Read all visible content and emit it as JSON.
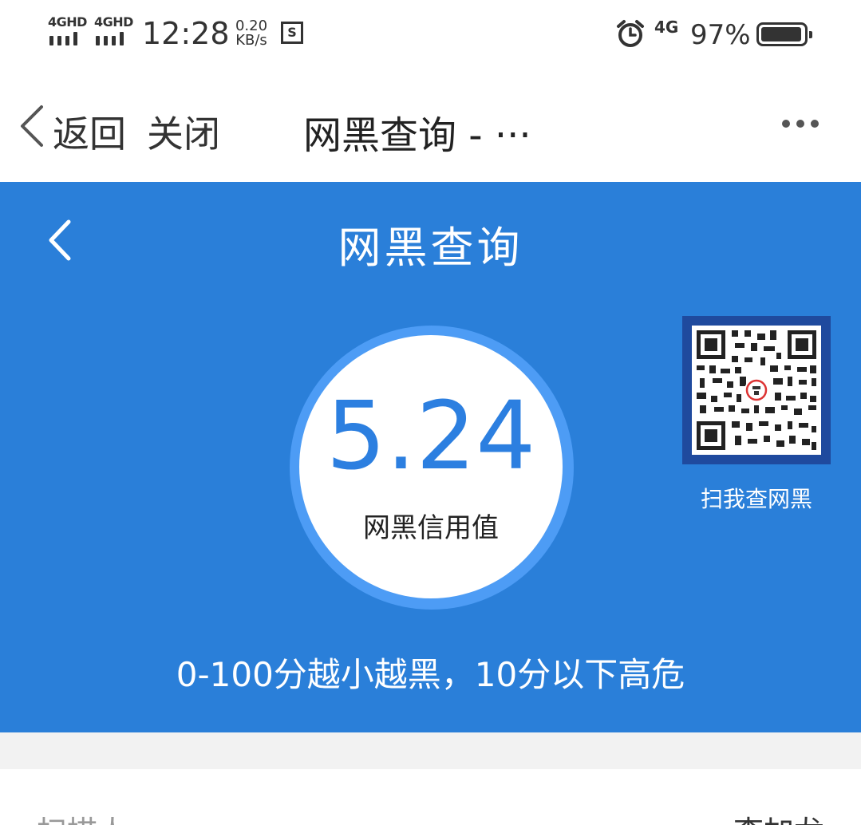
{
  "status": {
    "sim1_label": "4GHD",
    "sim2_label": "4GHD",
    "time": "12:28",
    "speed_value": "0.20",
    "speed_unit": "KB/s",
    "sim_icon_text": "S",
    "net_label": "4G",
    "battery": "97%",
    "battery_level": 0.97
  },
  "nav": {
    "back": "返回",
    "close": "关闭",
    "title": "网黑查询 - ···"
  },
  "panel": {
    "title": "网黑查询",
    "score": "5.24",
    "score_label": "网黑信用值",
    "qr_caption": "扫我查网黑",
    "hint": "0-100分越小越黑，10分以下高危"
  },
  "row": {
    "left": "扫描人",
    "right": "李加龙"
  },
  "colors": {
    "primary_blue": "#2a7fd9",
    "ring_blue": "#4d9cf5",
    "score_blue": "#2c7fe0",
    "qr_frame": "#1f4a9e"
  }
}
